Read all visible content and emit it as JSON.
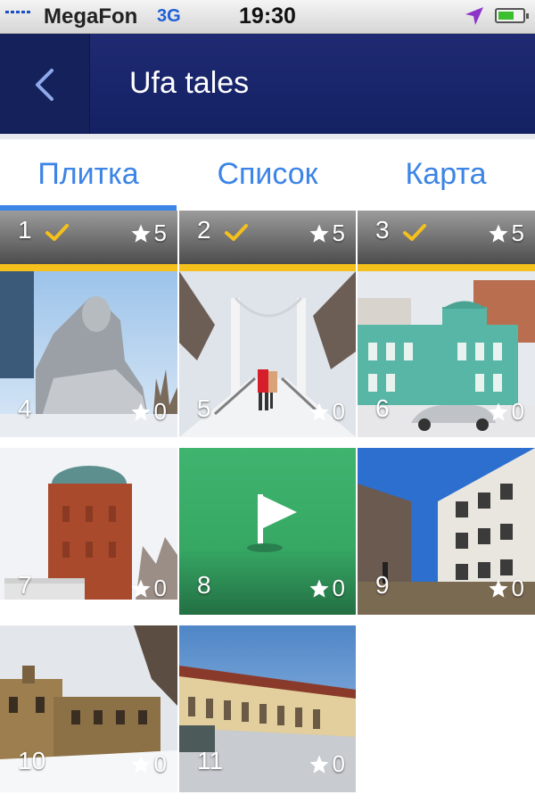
{
  "status_bar": {
    "carrier": "MegaFon",
    "network": "3G",
    "time": "19:30",
    "location_icon": "location-arrow-icon",
    "battery_icon": "battery-icon"
  },
  "nav": {
    "back_icon": "chevron-left-icon",
    "title": "Ufa tales"
  },
  "tabs": [
    {
      "label": "Плитка",
      "active": true
    },
    {
      "label": "Список",
      "active": false
    },
    {
      "label": "Карта",
      "active": false
    }
  ],
  "colors": {
    "nav_bg": "#1b2668",
    "accent": "#3c84e6",
    "highlight": "#f5c01b",
    "flag_tile": "#36a864"
  },
  "tiles": [
    {
      "number": "1",
      "rating": "5",
      "completed": true
    },
    {
      "number": "2",
      "rating": "5",
      "completed": true
    },
    {
      "number": "3",
      "rating": "5",
      "completed": true
    },
    {
      "number": "4",
      "rating": "0",
      "subject": "monument"
    },
    {
      "number": "5",
      "rating": "0",
      "subject": "bridge"
    },
    {
      "number": "6",
      "rating": "0",
      "subject": "mansion"
    },
    {
      "number": "7",
      "rating": "0",
      "subject": "water-tower"
    },
    {
      "number": "8",
      "rating": "0",
      "subject": "flag-icon"
    },
    {
      "number": "9",
      "rating": "0",
      "subject": "ruined-building"
    },
    {
      "number": "10",
      "rating": "0",
      "subject": "old-building"
    },
    {
      "number": "11",
      "rating": "0",
      "subject": "street"
    }
  ]
}
